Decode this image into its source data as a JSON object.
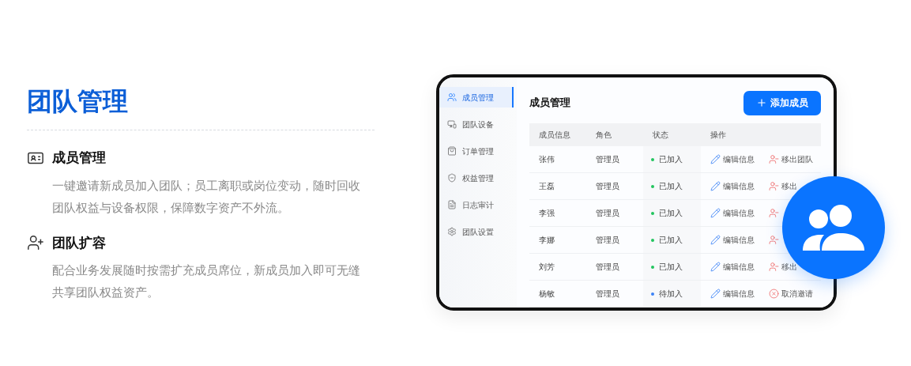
{
  "title": "团队管理",
  "features": [
    {
      "title": "成员管理",
      "text": "一键邀请新成员加入团队；员工离职或岗位变动，随时回收团队权益与设备权限，保障数字资产不外流。"
    },
    {
      "title": "团队扩容",
      "text": "配合业务发展随时按需扩充成员席位，新成员加入即可无缝共享团队权益资产。"
    }
  ],
  "app": {
    "sidebar": {
      "items": [
        {
          "label": "成员管理",
          "selected": true
        },
        {
          "label": "团队设备",
          "selected": false
        },
        {
          "label": "订单管理",
          "selected": false
        },
        {
          "label": "权益管理",
          "selected": false
        },
        {
          "label": "日志审计",
          "selected": false
        },
        {
          "label": "团队设置",
          "selected": false
        }
      ]
    },
    "heading": "成员管理",
    "add_button": "添加成员",
    "table": {
      "columns": [
        "成员信息",
        "角色",
        "状态",
        "操作"
      ],
      "rows": [
        {
          "name": "张伟",
          "role": "管理员",
          "status": "已加入",
          "color": "#22c55e",
          "actions": [
            {
              "kind": "edit",
              "label": "编辑信息"
            },
            {
              "kind": "remove",
              "label": "移出团队"
            }
          ]
        },
        {
          "name": "王磊",
          "role": "管理员",
          "status": "已加入",
          "color": "#22c55e",
          "actions": [
            {
              "kind": "edit",
              "label": "编辑信息"
            },
            {
              "kind": "remove",
              "label": "移出"
            }
          ]
        },
        {
          "name": "李强",
          "role": "管理员",
          "status": "已加入",
          "color": "#22c55e",
          "actions": [
            {
              "kind": "edit",
              "label": "编辑信息"
            },
            {
              "kind": "remove"
            }
          ]
        },
        {
          "name": "李娜",
          "role": "管理员",
          "status": "已加入",
          "color": "#22c55e",
          "actions": [
            {
              "kind": "edit",
              "label": "编辑信息"
            },
            {
              "kind": "remove"
            }
          ]
        },
        {
          "name": "刘芳",
          "role": "管理员",
          "status": "已加入",
          "color": "#22c55e",
          "actions": [
            {
              "kind": "edit",
              "label": "编辑信息"
            },
            {
              "kind": "remove",
              "label": "移出"
            }
          ]
        },
        {
          "name": "杨敏",
          "role": "管理员",
          "status": "待加入",
          "color": "#3b82f6",
          "actions": [
            {
              "kind": "edit",
              "label": "编辑信息"
            },
            {
              "kind": "cancel",
              "label": "取消邀请"
            }
          ]
        }
      ]
    }
  }
}
